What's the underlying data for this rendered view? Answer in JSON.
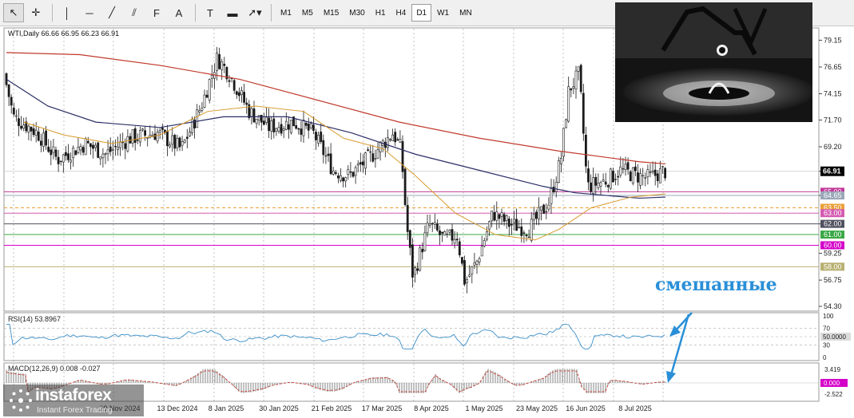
{
  "toolbar": {
    "tools": [
      {
        "name": "cursor-icon",
        "glyph": "↖",
        "active": true
      },
      {
        "name": "crosshair-icon",
        "glyph": "✛",
        "active": false
      },
      {
        "name": "vertical-line-icon",
        "glyph": "│",
        "active": false
      },
      {
        "name": "horizontal-line-icon",
        "glyph": "─",
        "active": false
      },
      {
        "name": "trendline-icon",
        "glyph": "╱",
        "active": false
      },
      {
        "name": "equidistant-channel-icon",
        "glyph": "⫽",
        "active": false
      },
      {
        "name": "fibonacci-icon",
        "glyph": "F",
        "active": false
      },
      {
        "name": "text-icon",
        "glyph": "A",
        "active": false
      },
      {
        "name": "text-label-icon",
        "glyph": "T",
        "active": false
      },
      {
        "name": "rectangle-shape-icon",
        "glyph": "▬",
        "active": false
      },
      {
        "name": "arrow-icon",
        "glyph": "➚▾",
        "active": false
      }
    ],
    "timeframes": [
      {
        "label": "M1",
        "active": false
      },
      {
        "label": "M5",
        "active": false
      },
      {
        "label": "M15",
        "active": false
      },
      {
        "label": "M30",
        "active": false
      },
      {
        "label": "H1",
        "active": false
      },
      {
        "label": "H4",
        "active": false
      },
      {
        "label": "D1",
        "active": true
      },
      {
        "label": "W1",
        "active": false
      },
      {
        "label": "MN",
        "active": false
      }
    ]
  },
  "chart": {
    "symbol_header": "WTI,Daily  66.66 66.95 66.23 66.91",
    "price_axis_ticks": [
      "79.15",
      "76.65",
      "74.15",
      "71.70",
      "69.20",
      "66.91",
      "64.65",
      "62.00",
      "59.25",
      "56.75",
      "54.30"
    ],
    "price_level_labels": [
      {
        "label": "65.00",
        "price": 65.0,
        "color": "#c0399a"
      },
      {
        "label": "64.65",
        "price": 64.65,
        "color": "#9aa7b8"
      },
      {
        "label": "63.50",
        "price": 63.5,
        "color": "#e9a13a"
      },
      {
        "label": "63.00",
        "price": 63.0,
        "color": "#d45bb0"
      },
      {
        "label": "62.00",
        "price": 62.0,
        "color": "#505060"
      },
      {
        "label": "61.00",
        "price": 61.0,
        "color": "#39a845"
      },
      {
        "label": "60.00",
        "price": 60.0,
        "color": "#d400c8"
      },
      {
        "label": "58.00",
        "price": 58.0,
        "color": "#b8b070"
      }
    ],
    "current_price_label": "66.91",
    "date_labels": [
      "29 Nov 2024",
      "13 Dec 2024",
      "8 Jan 2025",
      "30 Jan 2025",
      "21 Feb 2025",
      "17 Mar 2025",
      "8 Apr 2025",
      "1 May 2025",
      "23 May 2025",
      "16 Jun 2025",
      "8 Jul 2025"
    ],
    "rsi": {
      "header": "RSI(14) 53.8967",
      "ticks": [
        "100",
        "70",
        "50.0000",
        "30",
        "0"
      ]
    },
    "macd": {
      "header": "MACD(12,26,9) 0.008 -0.027",
      "ticks": [
        "3.419",
        "0.000",
        "-2.522"
      ]
    },
    "annotation_text": "смешанные",
    "colors": {
      "candle": "#1a1a1a",
      "ma_red": "#c0392b",
      "ma_navy": "#2b2f66",
      "ma_orange": "#d89a2c",
      "rsi_line": "#3a8fc8",
      "macd_signal": "#c0392b",
      "annotation": "#2a8fd8"
    }
  },
  "chart_data": {
    "type": "line",
    "title": "WTI,Daily",
    "ohlc_last": {
      "open": 66.66,
      "high": 66.95,
      "low": 66.23,
      "close": 66.91
    },
    "x": [
      "29 Nov 2024",
      "13 Dec 2024",
      "8 Jan 2025",
      "30 Jan 2025",
      "21 Feb 2025",
      "17 Mar 2025",
      "8 Apr 2025",
      "1 May 2025",
      "23 May 2025",
      "16 Jun 2025",
      "8 Jul 2025"
    ],
    "series": [
      {
        "name": "price",
        "values": [
          68.0,
          70.0,
          76.5,
          72.5,
          70.0,
          68.0,
          58.5,
          58.0,
          62.0,
          74.0,
          67.0
        ]
      }
    ],
    "ylim": [
      54.3,
      80.0
    ]
  },
  "watermark": {
    "brand": "instaforex",
    "tagline": "Instant Forex Trading"
  }
}
